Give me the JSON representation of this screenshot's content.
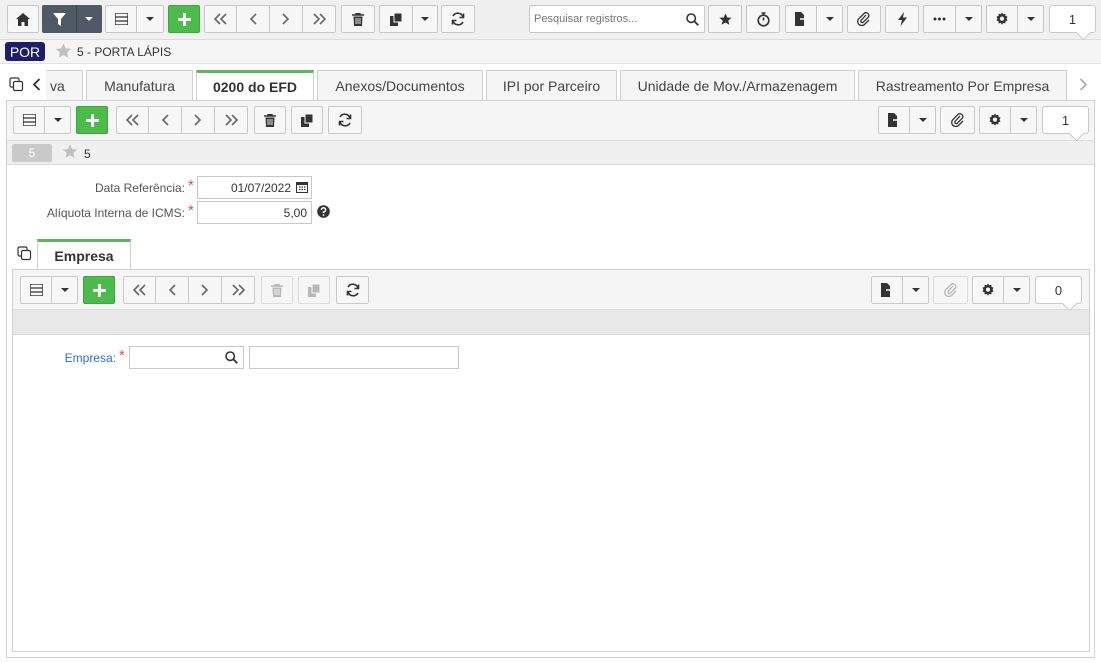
{
  "toolbar": {
    "search_placeholder": "Pesquisar registros...",
    "record_count": "1"
  },
  "record": {
    "lang_badge": "POR",
    "title": "5 - PORTA LÁPIS"
  },
  "tabs": [
    {
      "label": "va"
    },
    {
      "label": "Manufatura"
    },
    {
      "label": "0200 do EFD"
    },
    {
      "label": "Anexos/Documentos"
    },
    {
      "label": "IPI por Parceiro"
    },
    {
      "label": "Unidade de Mov./Armazenagem"
    },
    {
      "label": "Rastreamento Por Empresa"
    }
  ],
  "detail": {
    "record_count": "1",
    "id_badge": "5",
    "id_text": "5",
    "data_referencia_label": "Data Referência:",
    "data_referencia_value": "01/07/2022",
    "aliquota_label": "Alíquota Interna de ICMS:",
    "aliquota_value": "5,00"
  },
  "subtab": {
    "label": "Empresa",
    "record_count": "0",
    "empresa_label": "Empresa:"
  },
  "colors": {
    "accent_green": "#4cbb4c",
    "badge_navy": "#1d1d6b",
    "link_blue": "#2a6fc9"
  }
}
